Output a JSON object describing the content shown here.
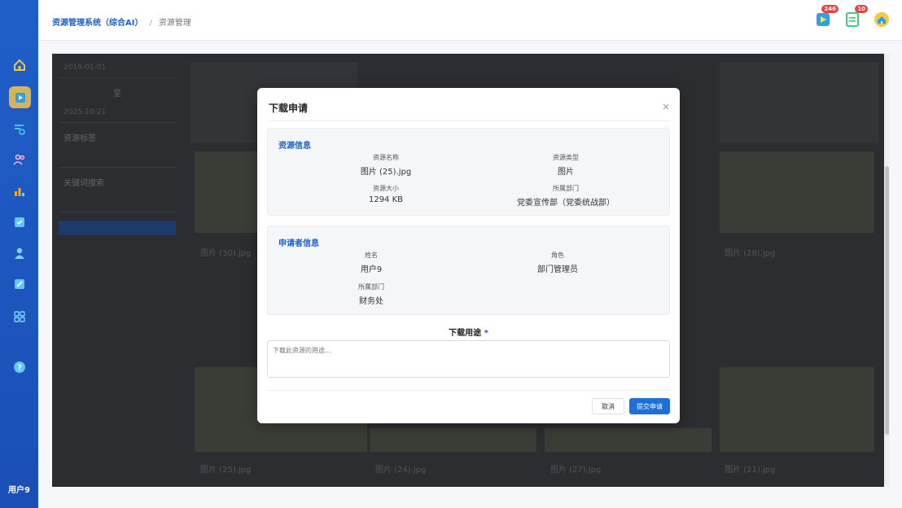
{
  "breadcrumb": {
    "system": "资源管理系统（综合AI）",
    "separator": "/",
    "current": "资源管理"
  },
  "topbar": {
    "icons": [
      {
        "name": "video-icon",
        "badge": "246"
      },
      {
        "name": "list-icon",
        "badge": "10"
      },
      {
        "name": "home-icon",
        "badge": ""
      }
    ]
  },
  "sidebar": {
    "items": [
      "home-icon",
      "media-icon",
      "search-list-icon",
      "users-icon",
      "chart-icon",
      "check-icon",
      "person-icon",
      "edit-icon",
      "apps-icon",
      "help-icon"
    ],
    "user": "用户9"
  },
  "background": {
    "filter": {
      "date_start": "2019-01-01",
      "to": "至",
      "date_end": "2025-10-21",
      "resource_label": "资源标签",
      "keyword_label": "关键词搜索"
    },
    "cards": [
      "图片 (30).jpg",
      "图片 (28).jpg",
      "图片 (25).jpg",
      "图片 (24).jpg",
      "图片 (27).jpg",
      "图片 (21).jpg"
    ]
  },
  "modal": {
    "title": "下载申请",
    "close": "×",
    "resource_section": {
      "title": "资源信息",
      "name_label": "资源名称",
      "name_value": "图片 (25).jpg",
      "type_label": "资源类型",
      "type_value": "图片",
      "size_label": "资源大小",
      "size_value": "1294 KB",
      "dept_label": "所属部门",
      "dept_value": "党委宣传部（党委统战部）"
    },
    "applicant_section": {
      "title": "申请者信息",
      "name_label": "姓名",
      "name_value": "用户9",
      "role_label": "角色",
      "role_value": "部门管理员",
      "dept_label": "所属部门",
      "dept_value": "财务处"
    },
    "purpose": {
      "label": "下载用途",
      "required": "*",
      "placeholder": "下载此资源的用途..."
    },
    "cancel": "取消",
    "submit": "提交申请"
  },
  "colors": {
    "primary": "#1f6fd8",
    "sidebar": "#1f5fc8",
    "active": "#d6b35a"
  }
}
